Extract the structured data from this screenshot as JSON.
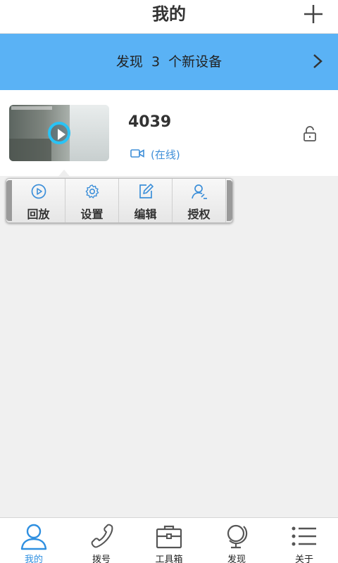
{
  "header": {
    "title": "我的"
  },
  "banner": {
    "text": "发现  3  个新设备"
  },
  "device": {
    "name": "4039",
    "status": "(在线)"
  },
  "popup_menu": {
    "items": [
      {
        "label": "回放",
        "icon": "playback-icon"
      },
      {
        "label": "设置",
        "icon": "gear-icon"
      },
      {
        "label": "编辑",
        "icon": "edit-icon"
      },
      {
        "label": "授权",
        "icon": "user-auth-icon"
      }
    ]
  },
  "tabs": [
    {
      "label": "我的",
      "icon": "user-icon",
      "active": true
    },
    {
      "label": "拨号",
      "icon": "phone-icon"
    },
    {
      "label": "工具箱",
      "icon": "toolbox-icon"
    },
    {
      "label": "发现",
      "icon": "globe-icon"
    },
    {
      "label": "关于",
      "icon": "list-icon"
    }
  ],
  "colors": {
    "accent": "#2e8fe0",
    "banner": "#5ab2f5",
    "status": "#3f8fd8"
  }
}
